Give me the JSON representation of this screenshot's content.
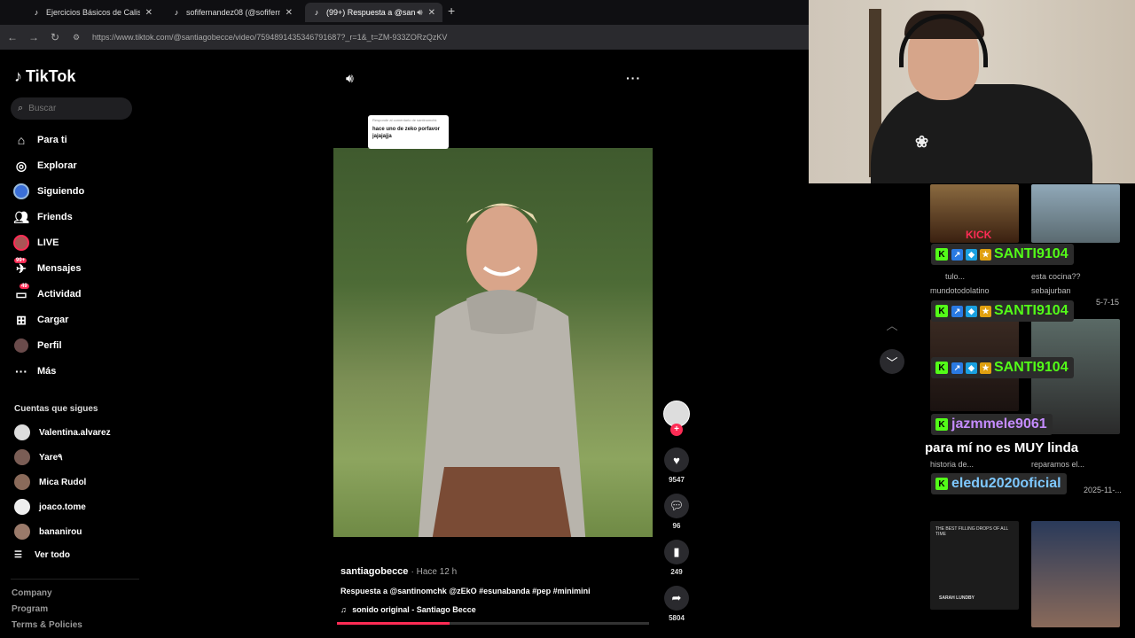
{
  "browser": {
    "tabs": [
      {
        "title": "Ejercicios Básicos de Calistenia",
        "active": false
      },
      {
        "title": "sofifernandez08 (@sofifernandez",
        "active": false
      },
      {
        "title": "(99+) Respuesta a @santino",
        "active": true
      }
    ],
    "new_tab": "+",
    "url": "https://www.tiktok.com/@santiagobecce/video/7594891435346791687?_r=1&_t=ZM-933ZORzQzKV"
  },
  "tiktok": {
    "logo": "TikTok",
    "search_placeholder": "Buscar",
    "nav": [
      {
        "label": "Para ti",
        "icon": "home-icon"
      },
      {
        "label": "Explorar",
        "icon": "compass-icon"
      },
      {
        "label": "Siguiendo",
        "icon": "following-icon"
      },
      {
        "label": "Friends",
        "icon": "friends-icon"
      },
      {
        "label": "LIVE",
        "icon": "live-icon"
      },
      {
        "label": "Mensajes",
        "icon": "messages-icon",
        "badge": "99+"
      },
      {
        "label": "Actividad",
        "icon": "activity-icon",
        "badge": "49"
      },
      {
        "label": "Cargar",
        "icon": "upload-icon"
      },
      {
        "label": "Perfil",
        "icon": "profile-icon"
      },
      {
        "label": "Más",
        "icon": "more-icon"
      }
    ],
    "following_title": "Cuentas que sigues",
    "following": [
      "Valentina.alvarez",
      "Yare٩",
      "Mica Rudol",
      "joaco.tome",
      "bananirou"
    ],
    "see_all": "Ver todo",
    "footer": [
      "Company",
      "Program",
      "Terms & Policies"
    ]
  },
  "video": {
    "reply_sticker": {
      "header": "Responde al comentario de santinomchk",
      "text": "hace uno de zeko porfavor jajajajja"
    },
    "author": "santiagobecce",
    "time": "Hace 12 h",
    "caption": "Respuesta a @santinomchk @zEkO #esunabanda #pep #minimini",
    "sound": "sonido original - Santiago Becce",
    "progress": 0.36,
    "likes": "9547",
    "comments": "96",
    "saves": "249",
    "shares": "5804"
  },
  "stream": {
    "chat": [
      {
        "name": "SANTI9104",
        "color": "#53fc18",
        "badges": true
      },
      {
        "name": "SANTI9104",
        "color": "#53fc18",
        "badges": true
      },
      {
        "name": "SANTI9104",
        "color": "#53fc18",
        "badges": true
      },
      {
        "name": "jazmmele9061",
        "color": "#c58cff",
        "badges": false
      },
      {
        "name": "eledu2020oficial",
        "color": "#7ec8ff",
        "badges": false
      }
    ],
    "message": "para mí no es MUY linda",
    "bg_text": {
      "a": "esta cocina??",
      "b": "mundotodolatino",
      "c": "sebajurban",
      "d": "tulo...",
      "e": "historia de...",
      "f": "reparamos el...",
      "g": "5-7-15",
      "h": "2025-11-...",
      "i": "KICK",
      "j": "THE BEST FILLING DROPS OF ALL TIME",
      "k": "SARAH LUNDBY"
    }
  },
  "colors": {
    "accent": "#fe2c55",
    "kick_green": "#53fc18"
  }
}
